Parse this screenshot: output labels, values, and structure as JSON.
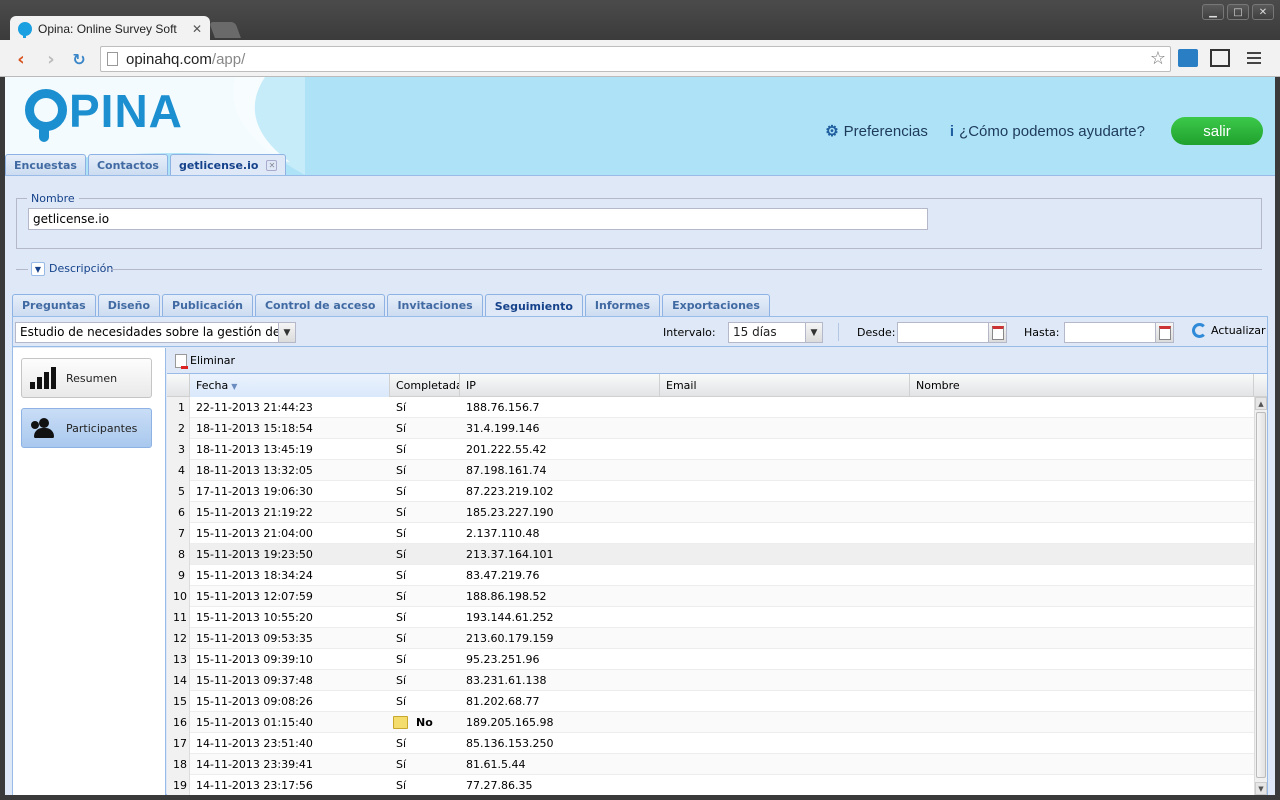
{
  "browser": {
    "tab_title": "Opina: Online Survey Soft",
    "tab_close": "✕",
    "url_host": "opinahq.com",
    "url_path": "/app/",
    "window_buttons": [
      "▁",
      "□",
      "✕"
    ]
  },
  "header": {
    "logo_text": "PINA",
    "preferences_label": "Preferencias",
    "help_label": "¿Cómo podemos ayudarte?",
    "logout_label": "salir"
  },
  "main_tabs": [
    {
      "label": "Encuestas"
    },
    {
      "label": "Contactos"
    },
    {
      "label": "getlicense.io",
      "closable_mark": "✕"
    }
  ],
  "form": {
    "nombre_legend": "Nombre",
    "nombre_value": "getlicense.io",
    "descripcion_label": "Descripción"
  },
  "sub_tabs": [
    "Preguntas",
    "Diseño",
    "Publicación",
    "Control de acceso",
    "Invitaciones",
    "Seguimiento",
    "Informes",
    "Exportaciones"
  ],
  "active_sub_tab": "Seguimiento",
  "filters": {
    "survey_value": "Estudio de necesidades sobre la gestión de lic",
    "intervalo_label": "Intervalo:",
    "intervalo_value": "15 días",
    "desde_label": "Desde:",
    "hasta_label": "Hasta:",
    "desde_value": "",
    "hasta_value": "",
    "refresh_label": "Actualizar"
  },
  "side_nav": [
    {
      "label": "Resumen",
      "icon": "bar-chart-icon"
    },
    {
      "label": "Participantes",
      "icon": "people-icon"
    }
  ],
  "grid": {
    "delete_label": "Eliminar",
    "columns": [
      "Fecha",
      "Completada",
      "IP",
      "Email",
      "Nombre"
    ],
    "rows": [
      {
        "n": "1",
        "fecha": "22-11-2013 21:44:23",
        "completada": "Sí",
        "ip": "188.76.156.7",
        "email": "",
        "nombre": ""
      },
      {
        "n": "2",
        "fecha": "18-11-2013 15:18:54",
        "completada": "Sí",
        "ip": "31.4.199.146",
        "email": "",
        "nombre": ""
      },
      {
        "n": "3",
        "fecha": "18-11-2013 13:45:19",
        "completada": "Sí",
        "ip": "201.222.55.42",
        "email": "",
        "nombre": ""
      },
      {
        "n": "4",
        "fecha": "18-11-2013 13:32:05",
        "completada": "Sí",
        "ip": "87.198.161.74",
        "email": "",
        "nombre": ""
      },
      {
        "n": "5",
        "fecha": "17-11-2013 19:06:30",
        "completada": "Sí",
        "ip": "87.223.219.102",
        "email": "",
        "nombre": ""
      },
      {
        "n": "6",
        "fecha": "15-11-2013 21:19:22",
        "completada": "Sí",
        "ip": "185.23.227.190",
        "email": "",
        "nombre": ""
      },
      {
        "n": "7",
        "fecha": "15-11-2013 21:04:00",
        "completada": "Sí",
        "ip": "2.137.110.48",
        "email": "",
        "nombre": ""
      },
      {
        "n": "8",
        "fecha": "15-11-2013 19:23:50",
        "completada": "Sí",
        "ip": "213.37.164.101",
        "email": "",
        "nombre": ""
      },
      {
        "n": "9",
        "fecha": "15-11-2013 18:34:24",
        "completada": "Sí",
        "ip": "83.47.219.76",
        "email": "",
        "nombre": ""
      },
      {
        "n": "10",
        "fecha": "15-11-2013 12:07:59",
        "completada": "Sí",
        "ip": "188.86.198.52",
        "email": "",
        "nombre": ""
      },
      {
        "n": "11",
        "fecha": "15-11-2013 10:55:20",
        "completada": "Sí",
        "ip": "193.144.61.252",
        "email": "",
        "nombre": ""
      },
      {
        "n": "12",
        "fecha": "15-11-2013 09:53:35",
        "completada": "Sí",
        "ip": "213.60.179.159",
        "email": "",
        "nombre": ""
      },
      {
        "n": "13",
        "fecha": "15-11-2013 09:39:10",
        "completada": "Sí",
        "ip": "95.23.251.96",
        "email": "",
        "nombre": ""
      },
      {
        "n": "14",
        "fecha": "15-11-2013 09:37:48",
        "completada": "Sí",
        "ip": "83.231.61.138",
        "email": "",
        "nombre": ""
      },
      {
        "n": "15",
        "fecha": "15-11-2013 09:08:26",
        "completada": "Sí",
        "ip": "81.202.68.77",
        "email": "",
        "nombre": ""
      },
      {
        "n": "16",
        "fecha": "15-11-2013 01:15:40",
        "completada": "No",
        "ip": "189.205.165.98",
        "email": "",
        "nombre": ""
      },
      {
        "n": "17",
        "fecha": "14-11-2013 23:51:40",
        "completada": "Sí",
        "ip": "85.136.153.250",
        "email": "",
        "nombre": ""
      },
      {
        "n": "18",
        "fecha": "14-11-2013 23:39:41",
        "completada": "Sí",
        "ip": "81.61.5.44",
        "email": "",
        "nombre": ""
      },
      {
        "n": "19",
        "fecha": "14-11-2013 23:17:56",
        "completada": "Sí",
        "ip": "77.27.86.35",
        "email": "",
        "nombre": ""
      }
    ]
  },
  "colors": {
    "brand": "#1c8fd0",
    "header_bg": "#aee3f7",
    "logout_green": "#20a12e",
    "panel_bg": "#dfe8f6"
  }
}
